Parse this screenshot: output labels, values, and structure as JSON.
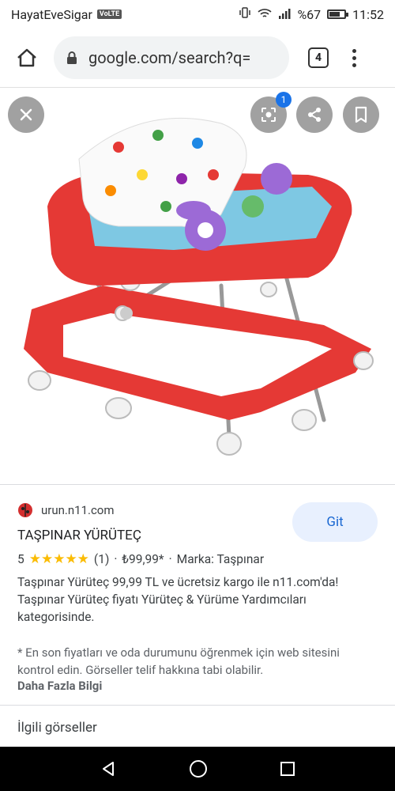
{
  "status": {
    "carrier": "HayatEveSigar",
    "volte": "VoLTE",
    "battery": "%67",
    "time": "11:52"
  },
  "browser": {
    "url": "google.com/search?q=",
    "tab_count": "4"
  },
  "viewer": {
    "lens_badge": "1"
  },
  "result": {
    "source": "urun.n11.com",
    "visit_label": "Git",
    "title": "TAŞPINAR YÜRÜTEÇ",
    "rating_value": "5",
    "stars": "★★★★★",
    "review_count": "(1)",
    "price": "₺99,99*",
    "brand": "Marka: Taşpınar",
    "description": "Taşpınar Yürüteç 99,99 TL ve ücretsiz kargo ile n11.com'da! Taşpınar Yürüteç fiyatı Yürüteç & Yürüme Yardımcıları kategorisinde.",
    "note": "* En son fiyatları ve oda durumunu öğrenmek için web sitesini kontrol edin. Görseller telif hakkına tabi olabilir.",
    "more_info": "Daha Fazla Bilgi",
    "related_heading": "İlgili görseller"
  }
}
